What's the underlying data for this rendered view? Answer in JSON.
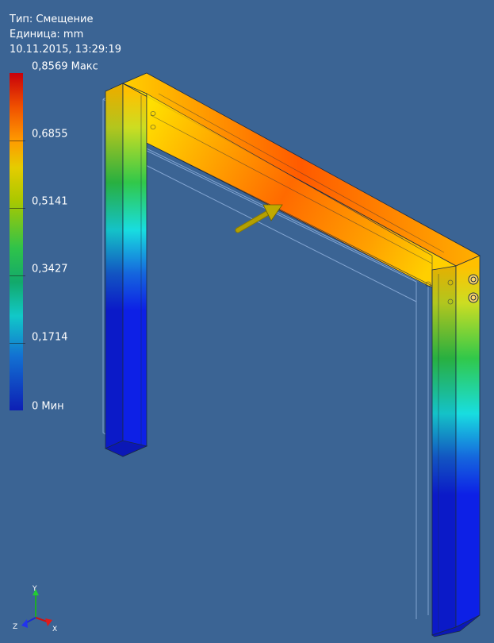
{
  "info": {
    "type_label": "Тип: Смещение",
    "unit_label": "Единица: mm",
    "timestamp": "10.11.2015, 13:29:19"
  },
  "legend": {
    "labels": [
      "0,8569 Макс",
      "0,6855",
      "0,5141",
      "0,3427",
      "0,1714",
      "0 Мин"
    ]
  },
  "triad": {
    "x_label": "X",
    "y_label": "Y",
    "z_label": "Z"
  },
  "colors": {
    "background": "#3b6494",
    "max": "#c8000a",
    "min": "#0d1fb4",
    "force_arrow": "#b4a000"
  }
}
